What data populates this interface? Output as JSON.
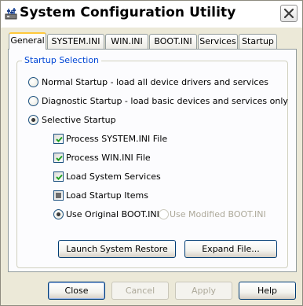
{
  "window": {
    "title": "System Configuration Utility"
  },
  "tabs": [
    {
      "label": "General",
      "active": true
    },
    {
      "label": "SYSTEM.INI",
      "active": false
    },
    {
      "label": "WIN.INI",
      "active": false
    },
    {
      "label": "BOOT.INI",
      "active": false
    },
    {
      "label": "Services",
      "active": false
    },
    {
      "label": "Startup",
      "active": false
    }
  ],
  "startup_selection": {
    "group_label": "Startup Selection",
    "normal": {
      "label": "Normal Startup - load all device drivers and services",
      "checked": false
    },
    "diagnostic": {
      "label": "Diagnostic Startup - load basic devices and services only",
      "checked": false
    },
    "selective": {
      "label": "Selective Startup",
      "checked": true
    },
    "options": [
      {
        "label": "Process SYSTEM.INI File",
        "state": "checked"
      },
      {
        "label": "Process WIN.INI File",
        "state": "checked"
      },
      {
        "label": "Load System Services",
        "state": "checked"
      },
      {
        "label": "Load Startup Items",
        "state": "indeterminate"
      }
    ],
    "boot_original": {
      "label": "Use Original BOOT.INI",
      "checked": true
    },
    "boot_modified": {
      "label": "Use Modified BOOT.INI",
      "checked": false,
      "disabled": true
    },
    "launch_restore_label": "Launch System Restore",
    "expand_file_label": "Expand File..."
  },
  "footer": {
    "close_label": "Close",
    "cancel_label": "Cancel",
    "apply_label": "Apply",
    "help_label": "Help"
  },
  "icons": {
    "app": "msconfig-app-icon",
    "close": "close-x-icon",
    "check": "checkmark-icon"
  },
  "colors": {
    "window_bg": "#ece9d8",
    "panel_bg": "#fcfcfe",
    "group_label": "#0046d5",
    "tab_active_accent": "#ffc83c",
    "disabled_text": "#aca899"
  }
}
